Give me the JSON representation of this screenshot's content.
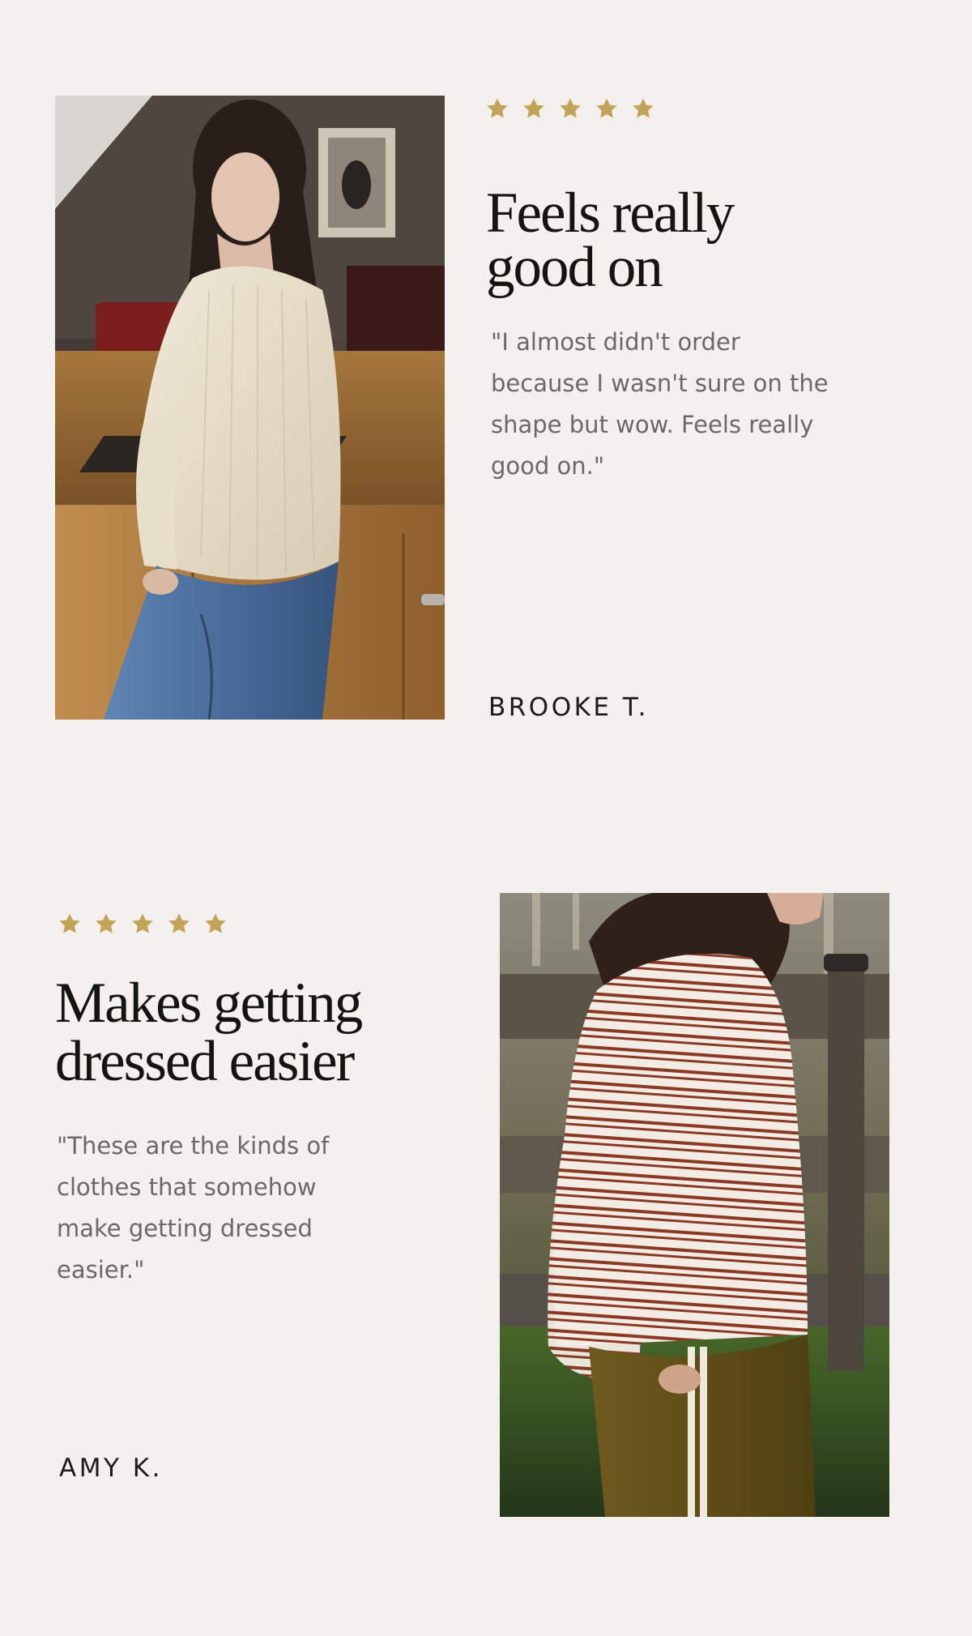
{
  "colors": {
    "background": "#f4f0ed",
    "star": "#c2a458",
    "headline": "#141414",
    "quote": "#6d6865",
    "author": "#1c1c1c"
  },
  "reviews": [
    {
      "rating": 5,
      "headline": "Feels really good on",
      "quote": "\"I almost didn't order because I wasn't sure on the shape but wow. Feels really good on.\"",
      "author": "BROOKE T.",
      "image": "woman-in-cream-blouse-photo"
    },
    {
      "rating": 5,
      "headline": "Makes getting dressed easier",
      "quote": "\"These are the kinds of clothes that somehow make getting dressed easier.\"",
      "author": "AMY K.",
      "image": "woman-in-striped-top-photo"
    }
  ],
  "icons": {
    "star": "star-icon"
  }
}
